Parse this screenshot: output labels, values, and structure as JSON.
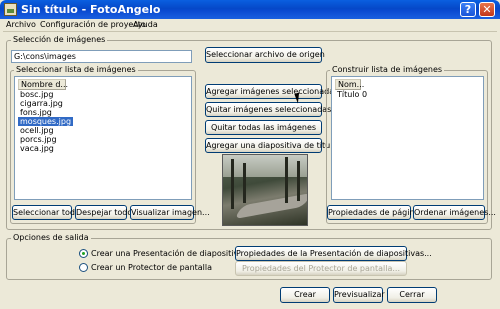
{
  "window": {
    "title": "Sin título - FotoAngelo",
    "help_label": "?",
    "close_label": "✕"
  },
  "menu": {
    "items": [
      "Archivo",
      "Configuración de proyecto",
      "Ayuda"
    ]
  },
  "image_selection": {
    "group_label": "Selección de imágenes",
    "path_value": "G:\\cons\\images",
    "select_source_button": "Seleccionar archivo de origen"
  },
  "image_list": {
    "group_label": "Seleccionar lista de imágenes",
    "column_header": "Nombre d...",
    "files": [
      "bosc.jpg",
      "cigarra.jpg",
      "fons.jpg",
      "mosques.jpg",
      "ocell.jpg",
      "porcs.jpg",
      "vaca.jpg"
    ],
    "selected_file": "mosques.jpg",
    "select_all_button": "Seleccionar todo",
    "deselect_all_button": "Despejar todo",
    "view_image_button": "Visualizar imagen..."
  },
  "middle_actions": {
    "add_selected": "Agregar imágenes seleccionadas",
    "remove_selected": "Quitar imágenes seleccionadas",
    "remove_all": "Quitar todas las imágenes",
    "add_title_slide": "Agregar una diapositiva de título"
  },
  "build_list": {
    "group_label": "Construir lista de imágenes",
    "column_header": "Nom...",
    "items": [
      "Título 0"
    ],
    "page_properties_button": "Propiedades de página",
    "sort_images_button": "Ordenar imágenes..."
  },
  "output_options": {
    "group_label": "Opciones de salida",
    "radio_presentation": "Crear una Presentación de diapositivas",
    "radio_screensaver": "Crear un Protector de pantalla",
    "selected_option": "presentation",
    "presentation_properties_button": "Propiedades de la Presentación de diapositivas...",
    "screensaver_properties_button": "Propiedades del Protector de pantalla..."
  },
  "footer": {
    "create_button": "Crear",
    "preview_button": "Previsualizar",
    "close_button": "Cerrar"
  }
}
